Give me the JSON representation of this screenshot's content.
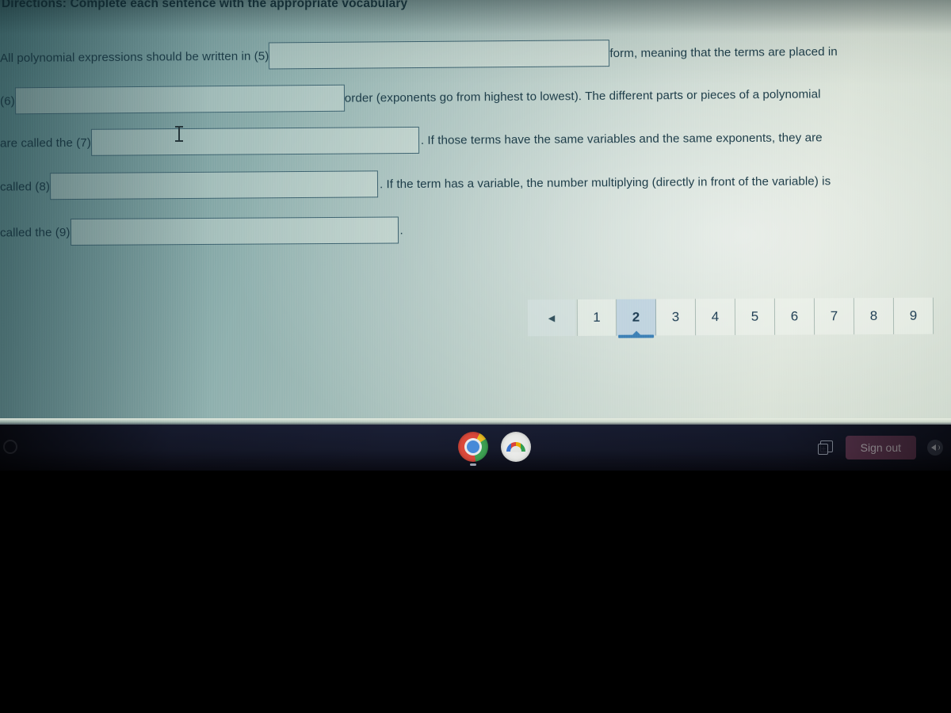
{
  "worksheet": {
    "directions": "Directions: Complete each sentence with the appropriate vocabulary",
    "lines": [
      {
        "number": "(5)",
        "prefix": "All polynomial expressions should be written in (5)",
        "suffix": "form, meaning that the terms are placed in",
        "blank_value": "",
        "blank_placeholder": ""
      },
      {
        "number": "(6)",
        "prefix": "(6)",
        "suffix": "order (exponents go from highest to lowest). The different parts or pieces of a polynomial",
        "blank_value": "",
        "blank_placeholder": ""
      },
      {
        "number": "(7)",
        "prefix": "are called the (7)",
        "suffix": ". If those terms have the same variables and the same exponents, they are",
        "blank_value": "",
        "blank_placeholder": ""
      },
      {
        "number": "(8)",
        "prefix": "called (8)",
        "suffix": ". If the term has a variable, the number multiplying (directly in front of the variable) is",
        "blank_value": "",
        "blank_placeholder": ""
      },
      {
        "number": "(9)",
        "prefix": "called the (9)",
        "suffix": ".",
        "blank_value": "",
        "blank_placeholder": ""
      }
    ]
  },
  "pagination": {
    "prev_label": "◀",
    "prev_name": "previous-page",
    "pages": [
      "1",
      "2",
      "3",
      "4",
      "5",
      "6",
      "7",
      "8",
      "9"
    ],
    "selected": "2",
    "accent_color": "#3d7fb5"
  },
  "shelf": {
    "launcher_label": "",
    "apps": [
      {
        "name": "chrome-app-icon",
        "label": "Chrome"
      },
      {
        "name": "google-app-icon",
        "label": "Google"
      }
    ],
    "status": {
      "new_desk_label": "+",
      "sign_out_label": "Sign out",
      "sign_out_color": "#a0567a",
      "volume_label": ""
    }
  }
}
